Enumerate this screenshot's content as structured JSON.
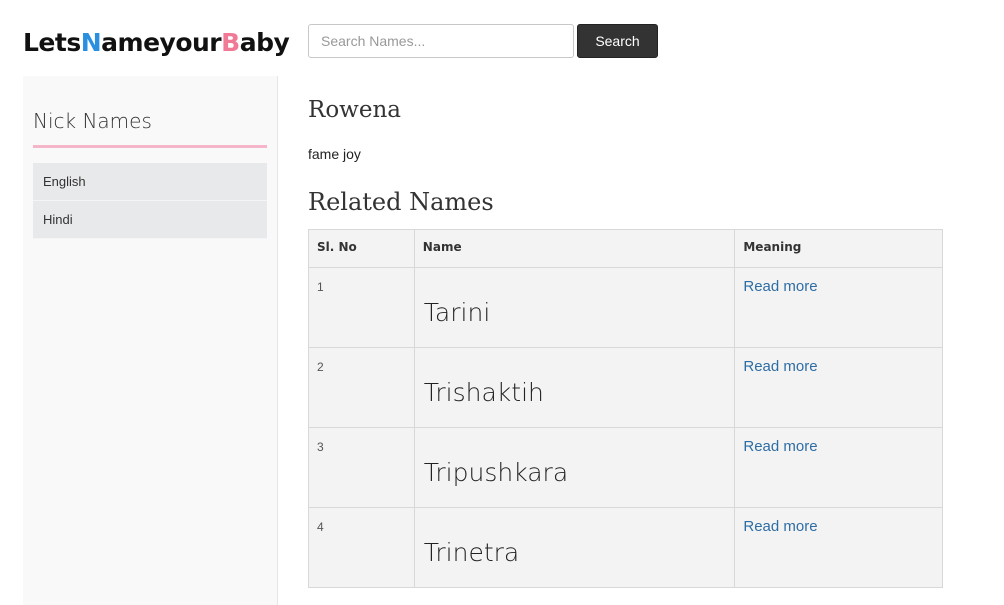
{
  "logo": {
    "part1": "Lets",
    "part2": "N",
    "part3": "ameyour",
    "part4": "B",
    "part5": "aby"
  },
  "search": {
    "placeholder": "Search Names...",
    "button_label": "Search"
  },
  "sidebar": {
    "title": "Nick Names",
    "items": [
      {
        "label": "English"
      },
      {
        "label": "Hindi"
      }
    ]
  },
  "main": {
    "name": "Rowena",
    "meaning": "fame joy",
    "related_title": "Related Names",
    "table": {
      "headers": {
        "no": "Sl. No",
        "name": "Name",
        "meaning": "Meaning"
      },
      "rows": [
        {
          "no": "1",
          "name": "Tarini",
          "link": "Read more"
        },
        {
          "no": "2",
          "name": "Trishaktih",
          "link": "Read more"
        },
        {
          "no": "3",
          "name": "Tripushkara",
          "link": "Read more"
        },
        {
          "no": "4",
          "name": "Trinetra",
          "link": "Read more"
        }
      ]
    }
  },
  "colors": {
    "logo_n": "#2b8fe0",
    "logo_b": "#f07a96",
    "sidebar_rule": "#f4b6c8",
    "link": "#2e6da4",
    "search_button": "#333333"
  }
}
